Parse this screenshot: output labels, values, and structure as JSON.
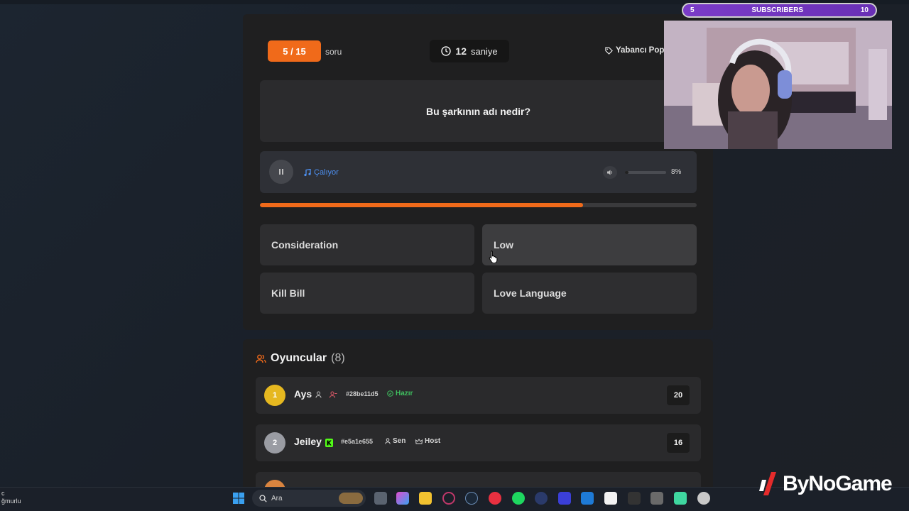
{
  "quiz": {
    "question_badge": "5 / 15",
    "question_suffix": "soru",
    "timer_value": "12",
    "timer_unit": "saniye",
    "genre": "Yabancı Pop",
    "question": "Bu şarkının adı nedir?",
    "player_status": "Çalıyor",
    "volume_percent": "8%",
    "volume_level": 0.08,
    "progress_level": 0.74,
    "answers": [
      "Consideration",
      "Low",
      "Kill Bill",
      "Love Language"
    ]
  },
  "players": {
    "title": "Oyuncular",
    "count": "(8)",
    "list": [
      {
        "rank": "1",
        "name": "Ays",
        "tag": "#28be11d5",
        "status": "Hazır",
        "score": "20"
      },
      {
        "rank": "2",
        "name": "Jeiley",
        "tag": "#e5a1e655",
        "you": "Sen",
        "host": "Host",
        "score": "16"
      }
    ]
  },
  "overlay": {
    "subs_left": "5",
    "subs_label": "SUBSCRIBERS",
    "subs_right": "10",
    "brand": "ByNoGame"
  },
  "taskbar": {
    "search_placeholder": "Ara",
    "corner_line1": "c",
    "corner_line2": "ğmurlu"
  },
  "colors": {
    "accent": "#f06a1a",
    "playing_blue": "#4d8ff0",
    "ready_green": "#3fbf5f",
    "gold": "#e6b820",
    "silver": "#9a9ca3"
  }
}
